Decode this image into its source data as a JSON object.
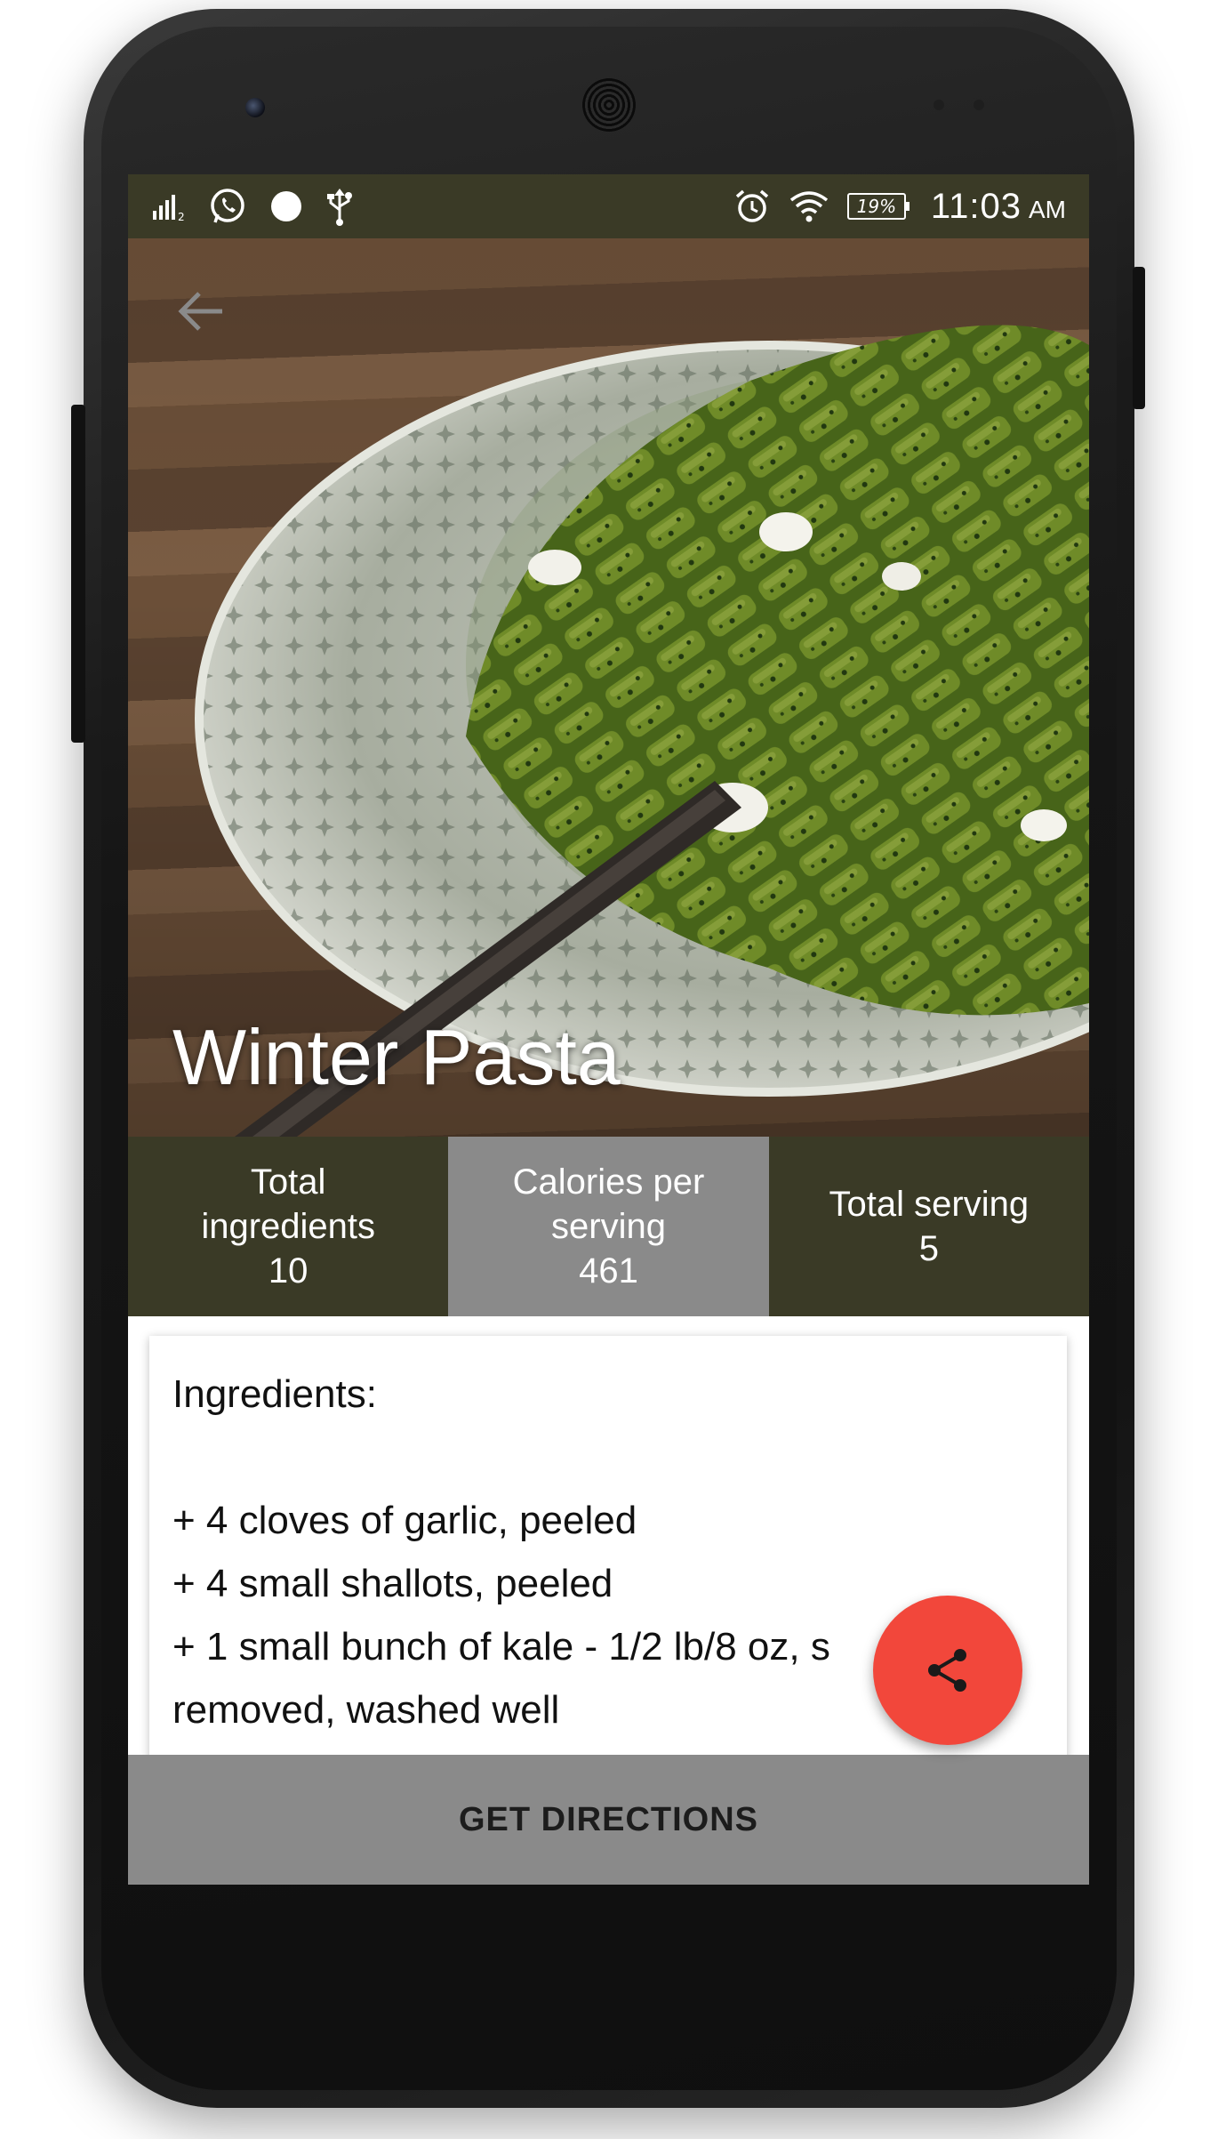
{
  "status_bar": {
    "time": "11:03",
    "ampm": "AM",
    "battery": "19%",
    "icons_left": [
      "signal-icon",
      "whatsapp-icon",
      "circle-notification-icon",
      "usb-icon"
    ],
    "icons_right": [
      "alarm-icon",
      "wifi-icon",
      "battery-icon"
    ]
  },
  "recipe": {
    "title": "Winter Pasta"
  },
  "stats": [
    {
      "line1": "Total",
      "line2": "ingredients",
      "value": "10"
    },
    {
      "line1": "Calories per",
      "line2": "serving",
      "value": "461"
    },
    {
      "line1": "Total serving",
      "line2": "",
      "value": "5"
    }
  ],
  "ingredients": {
    "heading": "Ingredients:",
    "items": [
      "+ 4 cloves of garlic, peeled",
      "+ 4 small shallots, peeled",
      "+ 1 small bunch of kale - 1/2 lb/8 oz, s",
      "removed, washed well"
    ]
  },
  "actions": {
    "get_directions": "GET DIRECTIONS",
    "share": "share"
  },
  "colors": {
    "status_bar": "#3a3a26",
    "stat_dark": "#3a3a26",
    "stat_grey": "#8a8a8a",
    "fab": "#f2473b",
    "bottom_button": "#8a8a8a"
  }
}
